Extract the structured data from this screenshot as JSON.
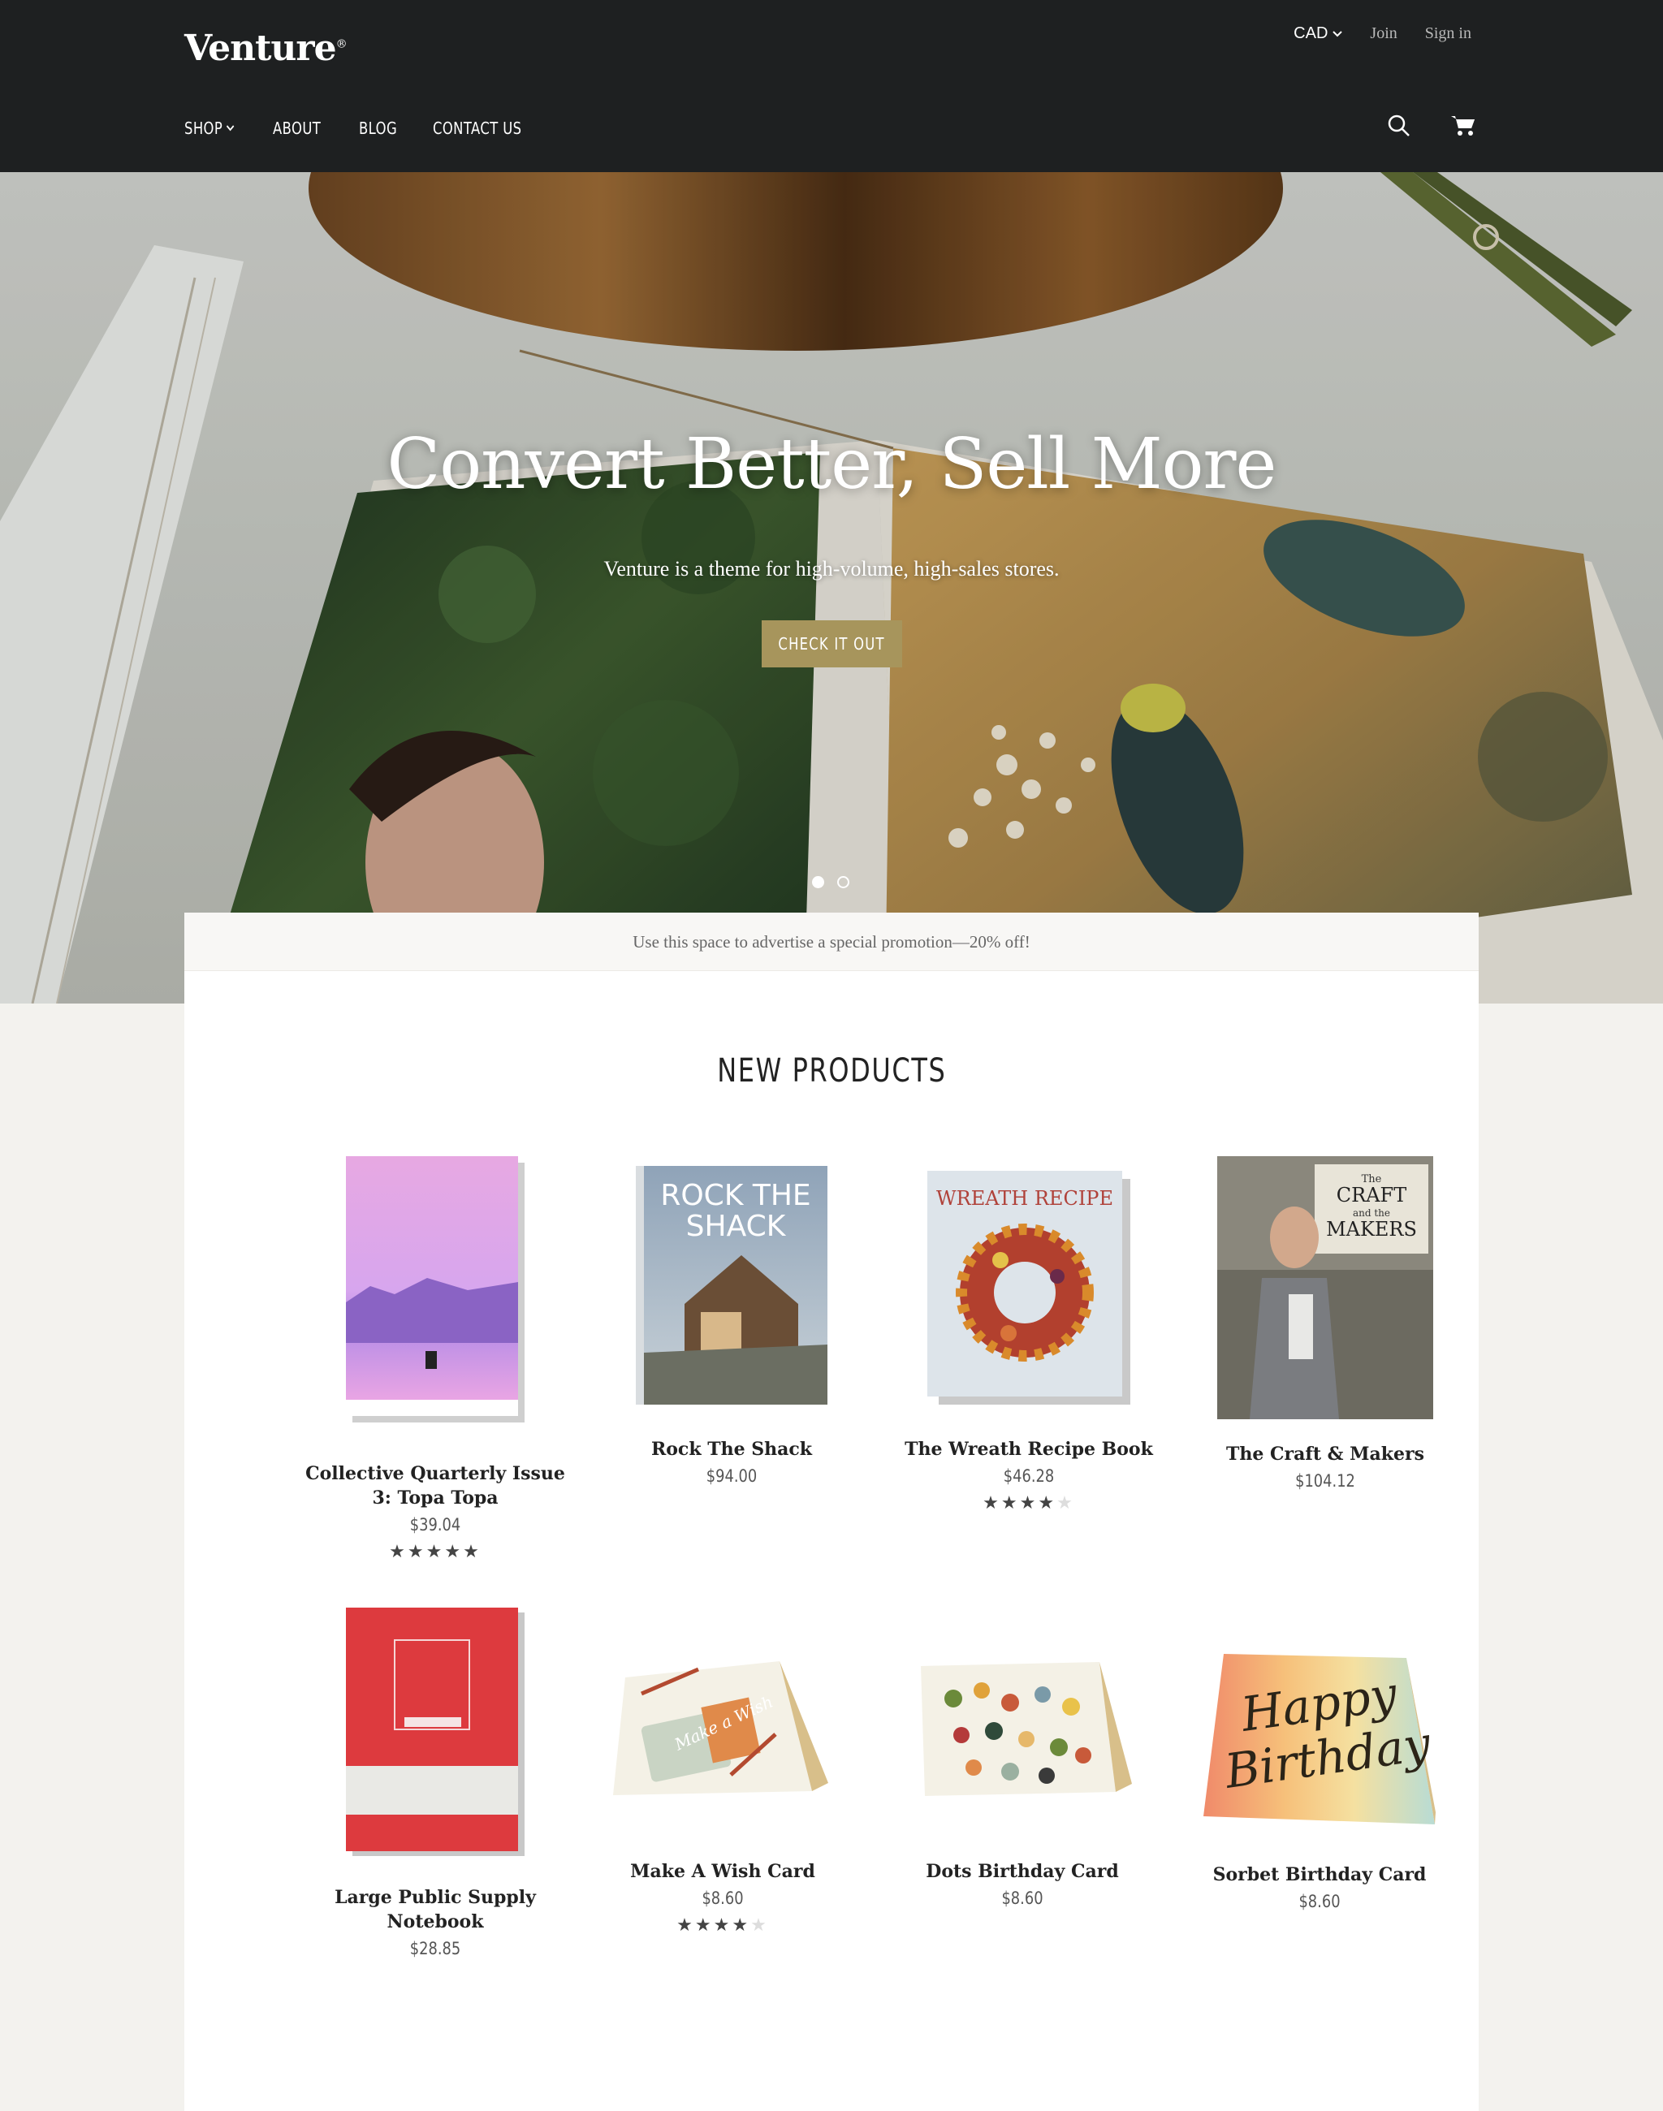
{
  "header": {
    "logo": "Venture",
    "logo_mark": "®",
    "currency": "CAD",
    "join": "Join",
    "sign_in": "Sign in",
    "nav": [
      "SHOP",
      "ABOUT",
      "BLOG",
      "CONTACT US"
    ]
  },
  "hero": {
    "title": "Convert Better, Sell More",
    "subtitle": "Venture is a theme for high-volume, high-sales stores.",
    "button": "CHECK IT OUT",
    "slides": 2,
    "active_slide": 1
  },
  "promo": "Use this space to advertise a special promotion—20% off!",
  "section_title": "NEW PRODUCTS",
  "products": [
    {
      "name": "Collective Quarterly Issue 3: Topa Topa",
      "price": "$39.04",
      "rating": 5
    },
    {
      "name": "Rock The Shack",
      "price": "$94.00",
      "rating": 0
    },
    {
      "name": "The Wreath Recipe Book",
      "price": "$46.28",
      "rating": 4
    },
    {
      "name": "The Craft & Makers",
      "price": "$104.12",
      "rating": 0
    },
    {
      "name": "Large Public Supply Notebook",
      "price": "$28.85",
      "rating": 0
    },
    {
      "name": "Make A Wish Card",
      "price": "$8.60",
      "rating": 4
    },
    {
      "name": "Dots Birthday Card",
      "price": "$8.60",
      "rating": 0
    },
    {
      "name": "Sorbet Birthday Card",
      "price": "$8.60",
      "rating": 0
    }
  ],
  "cover_text": {
    "rock": [
      "ROCK THE",
      "SHACK"
    ],
    "wreath": "WREATH RECIPE",
    "craft": [
      "The",
      "CRAFT",
      "and the",
      "MAKERS"
    ],
    "card_wish": "Make a Wish",
    "card_happy": "Happy",
    "card_birthday": "Birthday"
  },
  "colors": {
    "header_bg": "#1e2021",
    "accent": "#a7955c",
    "page_bg": "#f3f2ee"
  }
}
